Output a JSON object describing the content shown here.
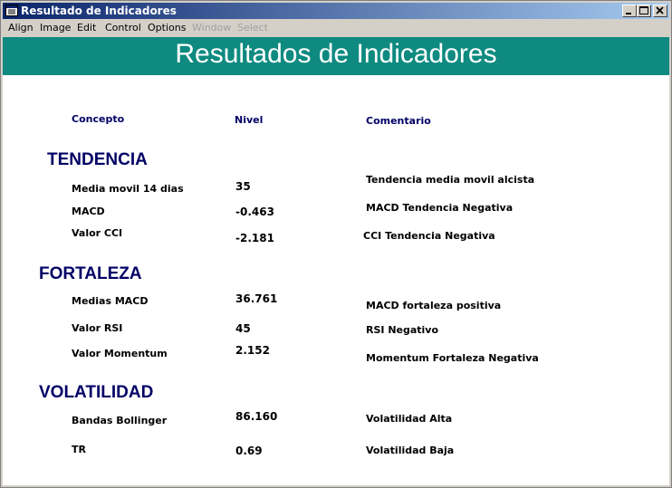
{
  "window": {
    "title": "Resultado de Indicadores",
    "title_color": "#0a246a"
  },
  "menu": [
    {
      "label": "Align",
      "enabled": true
    },
    {
      "label": "Image",
      "enabled": true
    },
    {
      "label": "Edit",
      "enabled": true
    },
    {
      "label": "Control",
      "enabled": true
    },
    {
      "label": "Options",
      "enabled": true
    },
    {
      "label": "Window",
      "enabled": false
    },
    {
      "label": "Select",
      "enabled": false
    }
  ],
  "banner": {
    "title": "Resultados de Indicadores",
    "color": "#0e8a80"
  },
  "columns": {
    "concept": "Concepto",
    "level": "Nivel",
    "comment": "Comentario"
  },
  "sections": [
    {
      "name": "TENDENCIA",
      "rows": [
        {
          "concept": "Media movil 14 dias",
          "level": "35",
          "comment": "Tendencia media movil alcista"
        },
        {
          "concept": "MACD",
          "level": "-0.463",
          "comment": "MACD Tendencia Negativa"
        },
        {
          "concept": "Valor CCI",
          "level": "-2.181",
          "comment": "CCI Tendencia Negativa"
        }
      ]
    },
    {
      "name": "FORTALEZA",
      "rows": [
        {
          "concept": "Medias MACD",
          "level": "36.761",
          "comment": "MACD fortaleza positiva"
        },
        {
          "concept": "Valor RSI",
          "level": "45",
          "comment": "RSI Negativo"
        },
        {
          "concept": "Valor Momentum",
          "level": "2.152",
          "comment": "Momentum Fortaleza Negativa"
        }
      ]
    },
    {
      "name": "VOLATILIDAD",
      "rows": [
        {
          "concept": "Bandas Bollinger",
          "level": "86.160",
          "comment": "Volatilidad Alta"
        },
        {
          "concept": "TR",
          "level": "0.69",
          "comment": "Volatilidad Baja"
        }
      ]
    }
  ]
}
